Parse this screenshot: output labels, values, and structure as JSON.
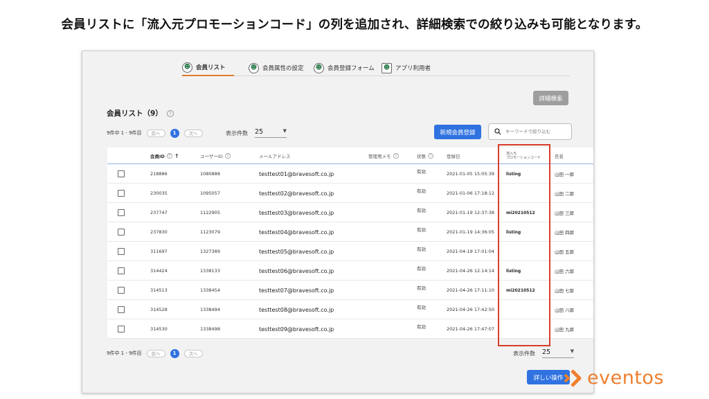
{
  "headline": "会員リストに「流入元プロモーションコード」の列を追加され、詳細検索での絞り込みも可能となります。",
  "tabs": [
    {
      "label": "会員リスト",
      "icon": "member-icon"
    },
    {
      "label": "会員属性の設定",
      "icon": "member-attribute-icon"
    },
    {
      "label": "会員登録フォーム",
      "icon": "registration-form-icon"
    },
    {
      "label": "アプリ利用者",
      "icon": "app-user-icon"
    }
  ],
  "advanced_search_label": "詳細検索",
  "section_title": "会員リスト（9）",
  "pager": {
    "summary": "9件中 1 - 9件目",
    "prev_label": "前へ",
    "next_label": "次へ",
    "current_page": "1"
  },
  "per_page": {
    "label": "表示件数",
    "value": "25"
  },
  "new_member_button": "新規会員登録",
  "search": {
    "placeholder": "キーワードで絞り込む"
  },
  "columns": {
    "member_id": "会員ID",
    "user_id": "ユーザーID",
    "email": "メールアドレス",
    "admin_memo": "管理用メモ",
    "status": "状態",
    "registered": "登録日",
    "promo_line1": "流入元",
    "promo_line2": "プロモーションコード",
    "name": "氏名"
  },
  "rows": [
    {
      "member_id": "218886",
      "user_id": "1080888",
      "email": "testtest01@bravesoft.co.jp",
      "memo": "",
      "status": "有効",
      "registered": "2021-01-05 15:05:39",
      "promo": "listing",
      "name": "山田 一郎"
    },
    {
      "member_id": "230035",
      "user_id": "1095057",
      "email": "testtest02@bravesoft.co.jp",
      "memo": "",
      "status": "有効",
      "registered": "2021-01-06 17:18:12",
      "promo": "",
      "name": "山田 二郎"
    },
    {
      "member_id": "237747",
      "user_id": "1122905",
      "email": "testtest03@bravesoft.co.jp",
      "memo": "",
      "status": "有効",
      "registered": "2021-01-19 12:37:38",
      "promo": "mi20210512",
      "name": "山田 三郎"
    },
    {
      "member_id": "237830",
      "user_id": "1123079",
      "email": "testtest04@bravesoft.co.jp",
      "memo": "",
      "status": "有効",
      "registered": "2021-01-19 14:36:05",
      "promo": "listing",
      "name": "山田 四郎"
    },
    {
      "member_id": "311697",
      "user_id": "1327389",
      "email": "testtest05@bravesoft.co.jp",
      "memo": "",
      "status": "有効",
      "registered": "2021-04-19 17:01:04",
      "promo": "",
      "name": "山田 五郎"
    },
    {
      "member_id": "314424",
      "user_id": "1338133",
      "email": "testtest06@bravesoft.co.jp",
      "memo": "",
      "status": "有効",
      "registered": "2021-04-26 12:14:14",
      "promo": "listing",
      "name": "山田 六郎"
    },
    {
      "member_id": "314513",
      "user_id": "1338454",
      "email": "testtest07@bravesoft.co.jp",
      "memo": "",
      "status": "有効",
      "registered": "2021-04-26 17:11:10",
      "promo": "mi20210512",
      "name": "山田 七郎"
    },
    {
      "member_id": "314528",
      "user_id": "1338494",
      "email": "testtest08@bravesoft.co.jp",
      "memo": "",
      "status": "有効",
      "registered": "2021-04-26 17:42:50",
      "promo": "",
      "name": "山田 八郎"
    },
    {
      "member_id": "314530",
      "user_id": "1338498",
      "email": "testtest09@bravesoft.co.jp",
      "memo": "",
      "status": "有効",
      "registered": "2021-04-26 17:47:07",
      "promo": "",
      "name": "山田 九郎"
    }
  ],
  "bulk_action_button": "詳しい操作",
  "logo_text": "eventos",
  "colors": {
    "accent_blue": "#2f72e0",
    "highlight_red": "#d93b2b",
    "brand_orange": "#ee7f2d",
    "tab_underline": "#e07b2a"
  }
}
